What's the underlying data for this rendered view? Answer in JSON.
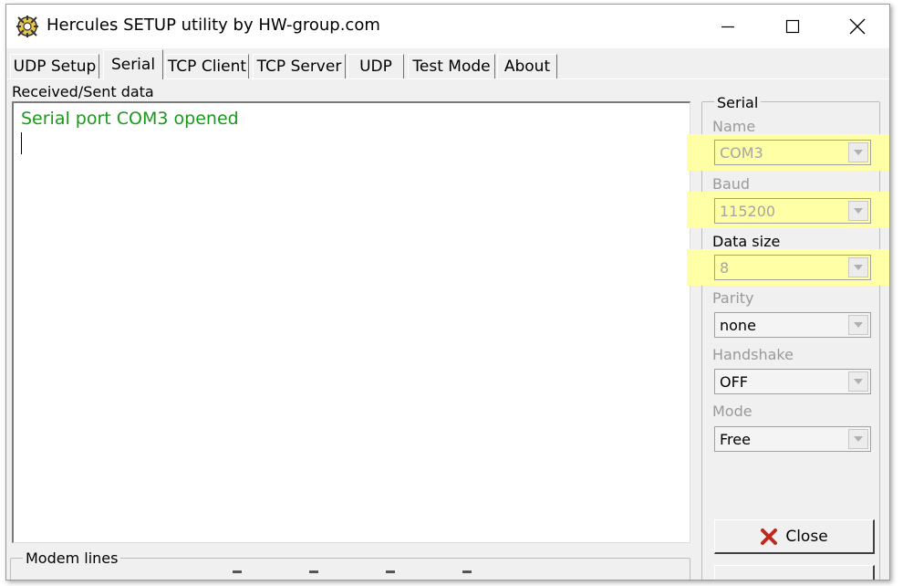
{
  "window": {
    "title": "Hercules SETUP utility by HW-group.com",
    "icon": "hercules-app-icon"
  },
  "titlebar_buttons": [
    "minimize-icon",
    "maximize-icon",
    "close-icon"
  ],
  "tabs": [
    {
      "label": "UDP Setup",
      "active": false
    },
    {
      "label": "Serial",
      "active": true
    },
    {
      "label": "TCP Client",
      "active": false
    },
    {
      "label": "TCP Server",
      "active": false
    },
    {
      "label": "UDP",
      "active": false
    },
    {
      "label": "Test Mode",
      "active": false
    },
    {
      "label": "About",
      "active": false
    }
  ],
  "received": {
    "label": "Received/Sent data",
    "text": "Serial port COM3 opened"
  },
  "modem": {
    "label": "Modem lines"
  },
  "serial": {
    "group_label": "Serial",
    "name": {
      "label": "Name",
      "value": "COM3"
    },
    "baud": {
      "label": "Baud",
      "value": "115200"
    },
    "data_size": {
      "label": "Data size",
      "value": "8"
    },
    "parity": {
      "label": "Parity",
      "value": "none"
    },
    "handshake": {
      "label": "Handshake",
      "value": "OFF"
    },
    "mode": {
      "label": "Mode",
      "value": "Free"
    },
    "close_label": "Close"
  },
  "colors": {
    "received_text": "#1a9a1a",
    "highlight": "#ffffa6",
    "close_icon": "#c0281e"
  }
}
